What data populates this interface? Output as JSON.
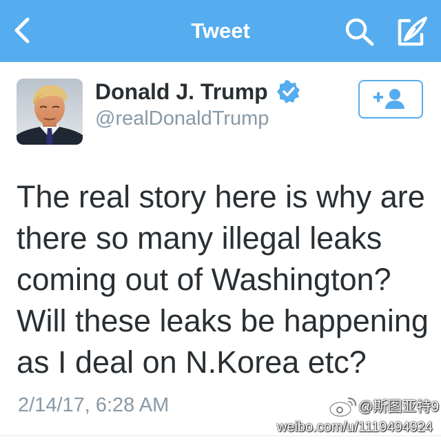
{
  "navbar": {
    "title": "Tweet",
    "back_icon": "chevron-left-icon",
    "search_icon": "search-icon",
    "compose_icon": "compose-tweet-icon",
    "background_color": "#55acee"
  },
  "author": {
    "display_name": "Donald J. Trump",
    "handle": "@realDonaldTrump",
    "verified": true,
    "verified_icon": "verified-badge-icon",
    "follow_icon": "follow-user-icon"
  },
  "tweet": {
    "lines": [
      "The real story here is why are",
      "there so many illegal leaks",
      "coming out of Washington?",
      "Will these leaks be happening",
      "as I deal on N.Korea etc?"
    ],
    "timestamp": "2/14/17, 6:28 AM"
  },
  "watermark": {
    "user": "@斯图亚特9",
    "url": "weibo.com/u/1119494924",
    "logo_icon": "weibo-logo-icon"
  },
  "colors": {
    "accent": "#55acee",
    "text_primary": "#292f33",
    "text_secondary": "#8899a6"
  }
}
